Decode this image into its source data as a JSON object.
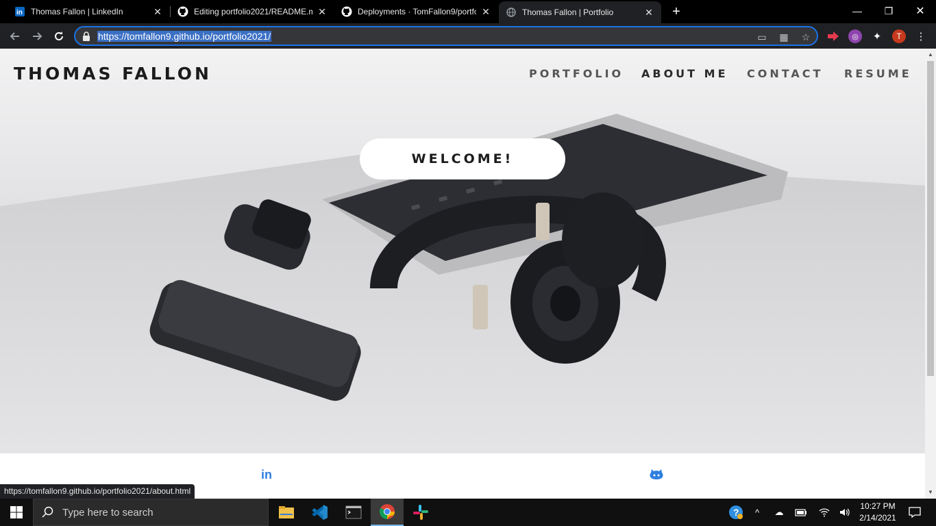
{
  "browser": {
    "tabs": [
      {
        "title": "Thomas Fallon | LinkedIn",
        "icon": "linkedin-icon",
        "active": false
      },
      {
        "title": "Editing portfolio2021/README.m",
        "icon": "github-icon",
        "active": false
      },
      {
        "title": "Deployments · TomFallon9/portfo",
        "icon": "github-icon",
        "active": false
      },
      {
        "title": "Thomas Fallon | Portfolio",
        "icon": "globe-icon",
        "active": true
      }
    ],
    "url": "https://tomfallon9.github.io/portfolio2021/",
    "profile_initial": "T",
    "status_url": "https://tomfallon9.github.io/portfolio2021/about.html",
    "accent": "#1a73e8"
  },
  "site": {
    "brand": "THOMAS FALLON",
    "nav": [
      {
        "label": "PORTFOLIO",
        "current": false
      },
      {
        "label": "ABOUT ME",
        "current": true
      },
      {
        "label": "CONTACT",
        "current": false
      },
      {
        "label": "RESUME",
        "current": false
      }
    ],
    "welcome": "WELCOME!",
    "social": [
      {
        "icon": "linkedin-icon",
        "glyph": "in"
      },
      {
        "icon": "github-icon",
        "glyph": ""
      }
    ],
    "social_color": "#2f7fe0"
  },
  "taskbar": {
    "search_placeholder": "Type here to search",
    "apps": [
      "file-explorer-icon",
      "vscode-icon",
      "terminal-icon",
      "chrome-icon",
      "slack-icon"
    ],
    "time": "10:27 PM",
    "date": "2/14/2021"
  }
}
